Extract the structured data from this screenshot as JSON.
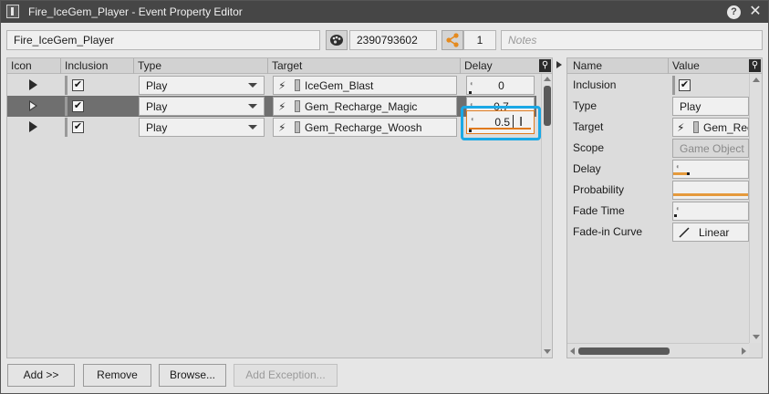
{
  "window": {
    "title": "Fire_IceGem_Player - Event Property Editor",
    "help_glyph": "?",
    "close_glyph": "✕"
  },
  "header": {
    "event_name": "Fire_IceGem_Player",
    "short_id": "2390793602",
    "share_count": "1",
    "notes_placeholder": "Notes"
  },
  "grid": {
    "columns": [
      "Icon",
      "Inclusion",
      "Type",
      "Target",
      "Delay"
    ],
    "rows": [
      {
        "type": "Play",
        "target": "IceGem_Blast",
        "delay": "0",
        "included": true,
        "selected": false
      },
      {
        "type": "Play",
        "target": "Gem_Recharge_Magic",
        "delay": "0.7",
        "included": true,
        "selected": true
      },
      {
        "type": "Play",
        "target": "Gem_Recharge_Woosh",
        "delay": "0.5",
        "included": true,
        "selected": false,
        "editing": true
      }
    ],
    "checkmark": "✔"
  },
  "properties": {
    "columns": [
      "Name",
      "Value"
    ],
    "rows": [
      {
        "name": "Inclusion",
        "value": "✔"
      },
      {
        "name": "Type",
        "value": "Play"
      },
      {
        "name": "Target",
        "value": "Gem_Rec"
      },
      {
        "name": "Scope",
        "value": "Game Object"
      },
      {
        "name": "Delay",
        "value": ""
      },
      {
        "name": "Probability",
        "value": ""
      },
      {
        "name": "Fade Time",
        "value": ""
      },
      {
        "name": "Fade-in Curve",
        "value": "Linear"
      }
    ]
  },
  "buttons": {
    "add": "Add >>",
    "remove": "Remove",
    "browse": "Browse...",
    "add_exception": "Add Exception..."
  },
  "colors": {
    "accent_focus": "#1aa8e6",
    "edit_border": "#e07a1e",
    "selected_row": "#6f6f6f"
  }
}
